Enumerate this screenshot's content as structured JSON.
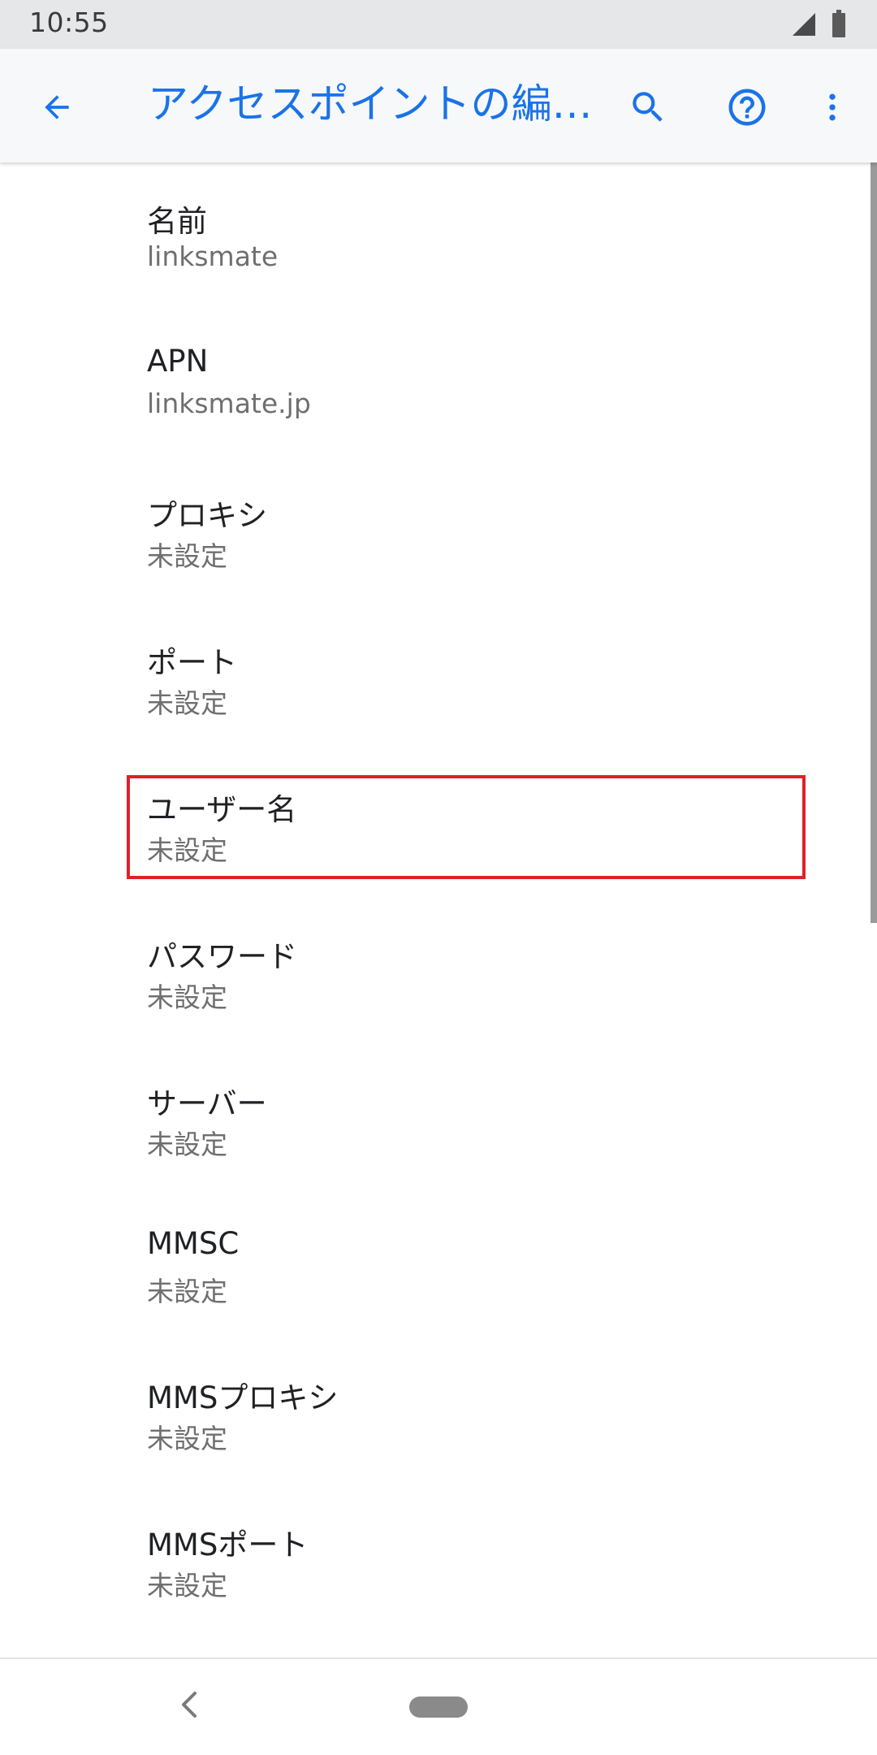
{
  "status_bar": {
    "time": "10:55",
    "signal_icon": "cellular-signal-icon",
    "battery_icon": "battery-icon"
  },
  "app_bar": {
    "title": "アクセスポイントの編…",
    "back_icon": "arrow-back-icon",
    "search_icon": "search-icon",
    "help_icon": "help-icon",
    "more_icon": "more-vert-icon",
    "accent_color": "#1a73e8"
  },
  "list": {
    "items": [
      {
        "title": "名前",
        "summary": "linksmate"
      },
      {
        "title": "APN",
        "summary": "linksmate.jp"
      },
      {
        "title": "プロキシ",
        "summary": "未設定"
      },
      {
        "title": "ポート",
        "summary": "未設定"
      },
      {
        "title": "ユーザー名",
        "summary": "未設定"
      },
      {
        "title": "パスワード",
        "summary": "未設定"
      },
      {
        "title": "サーバー",
        "summary": "未設定"
      },
      {
        "title": "MMSC",
        "summary": "未設定"
      },
      {
        "title": "MMSプロキシ",
        "summary": "未設定"
      },
      {
        "title": "MMSポート",
        "summary": "未設定"
      }
    ],
    "highlighted_item": "ユーザー名",
    "highlight_color": "#e0202a"
  },
  "nav_bar": {
    "back_icon": "nav-back-icon",
    "home_icon": "nav-home-pill-icon"
  }
}
